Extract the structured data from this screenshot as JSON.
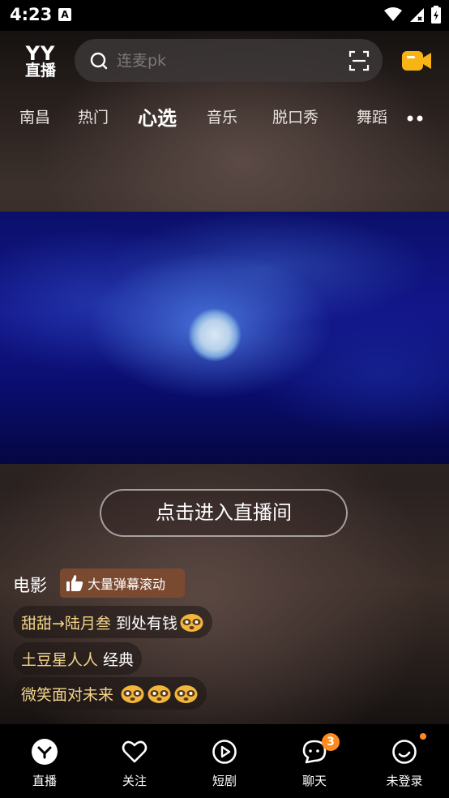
{
  "status_bar": {
    "time": "4:23",
    "notification_glyph": "A"
  },
  "header": {
    "logo_line1": "YY",
    "logo_line2": "直播",
    "search_placeholder": "连麦pk"
  },
  "tabs": [
    {
      "label": "南昌"
    },
    {
      "label": "热门"
    },
    {
      "label": "心选",
      "active": true
    },
    {
      "label": "音乐"
    },
    {
      "label": "脱口秀"
    },
    {
      "label": "舞蹈"
    }
  ],
  "stream": {
    "enter_button": "点击进入直播间",
    "category": "电影",
    "badge": "大量弹幕滚动"
  },
  "comments": [
    {
      "user": "甜甜→陆月叁",
      "message": "到处有钱",
      "emoji_count": 1
    },
    {
      "user": "土豆星人人",
      "message": "经典",
      "emoji_count": 0
    },
    {
      "user": "微笑面对未来",
      "message": "",
      "emoji_count": 3
    }
  ],
  "bottom_nav": [
    {
      "label": "直播",
      "icon": "yy-home-icon"
    },
    {
      "label": "关注",
      "icon": "heart-icon"
    },
    {
      "label": "短剧",
      "icon": "play-icon"
    },
    {
      "label": "聊天",
      "icon": "chat-bubble-icon",
      "badge": "3"
    },
    {
      "label": "未登录",
      "icon": "profile-icon",
      "dot": true
    }
  ],
  "colors": {
    "accent": "#ff8a1e",
    "username": "#f3d58a",
    "badge_bg": "#7a4a30"
  }
}
